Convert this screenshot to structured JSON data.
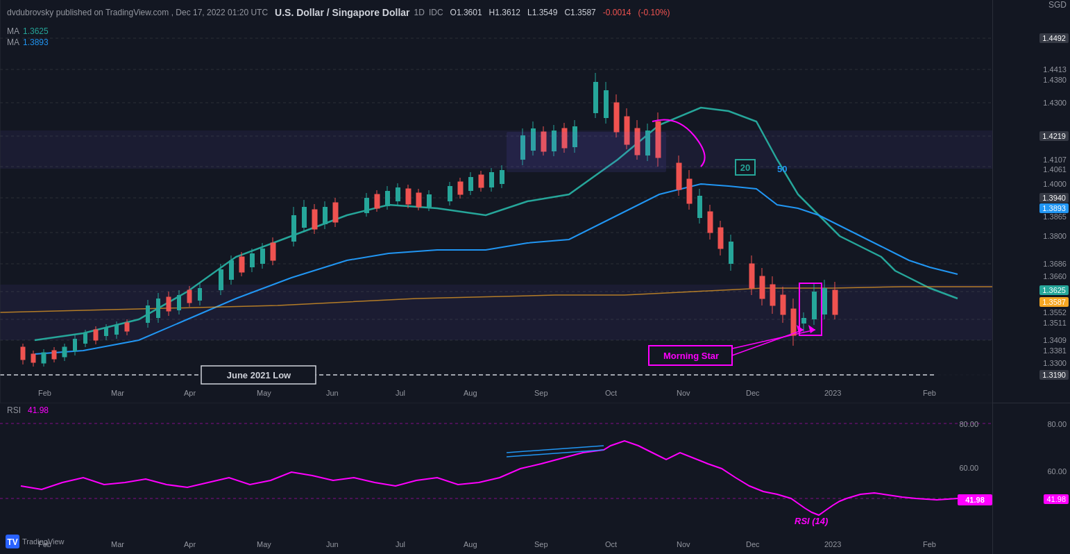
{
  "publisher": "dvdubrovsky",
  "platform": "TradingView.com",
  "date": "Dec 17, 2022 01:20 UTC",
  "symbol": {
    "name": "U.S. Dollar / Singapore Dollar",
    "timeframe": "1D",
    "source": "IDC",
    "open": "O1.3601",
    "high": "H1.3612",
    "low": "L1.3549",
    "close": "C1.3587",
    "change": "-0.0014",
    "change_pct": "(-0.10%)",
    "currency": "SGD"
  },
  "ma_lines": [
    {
      "label": "MA",
      "value": "1.3625",
      "color": "#26a69a"
    },
    {
      "label": "MA",
      "value": "1.3893",
      "color": "#2196f3"
    }
  ],
  "price_levels": [
    {
      "value": "1.4492",
      "type": "box",
      "color": "#363a45"
    },
    {
      "value": "1.4413",
      "type": "plain"
    },
    {
      "value": "1.4380",
      "type": "plain"
    },
    {
      "value": "1.4300",
      "type": "plain"
    },
    {
      "value": "1.4219",
      "type": "box",
      "color": "#363a45"
    },
    {
      "value": "1.4107",
      "type": "plain"
    },
    {
      "value": "1.4061",
      "type": "plain"
    },
    {
      "value": "1.4000",
      "type": "plain"
    },
    {
      "value": "1.3940",
      "type": "box",
      "color": "#363a45"
    },
    {
      "value": "1.3893",
      "type": "box",
      "color": "#2196f3"
    },
    {
      "value": "1.3865",
      "type": "plain"
    },
    {
      "value": "1.3800",
      "type": "plain"
    },
    {
      "value": "1.3686",
      "type": "plain"
    },
    {
      "value": "1.3660",
      "type": "plain"
    },
    {
      "value": "1.3625",
      "type": "box",
      "color": "#26a69a"
    },
    {
      "value": "1.3587",
      "type": "box",
      "color": "#f5a623"
    },
    {
      "value": "1.3552",
      "type": "plain"
    },
    {
      "value": "1.3511",
      "type": "plain"
    },
    {
      "value": "1.3409",
      "type": "plain"
    },
    {
      "value": "1.3381",
      "type": "plain"
    },
    {
      "value": "1.3300",
      "type": "plain"
    },
    {
      "value": "1.3190",
      "type": "box",
      "color": "#363a45"
    }
  ],
  "annotations": {
    "morning_star": "Morning Star",
    "june_2021_low": "June 2021 Low",
    "ma20": "20",
    "ma50": "50",
    "rsi_indicator": "RSI (14)"
  },
  "rsi": {
    "label": "RSI",
    "value": "41.98",
    "levels": [
      "80.00",
      "60.00",
      "41.98"
    ]
  },
  "time_labels": [
    "Feb",
    "Mar",
    "Apr",
    "May",
    "Jun",
    "Jul",
    "Aug",
    "Sep",
    "Oct",
    "Nov",
    "Dec",
    "2023",
    "Feb"
  ],
  "tradingview_logo": "TV"
}
